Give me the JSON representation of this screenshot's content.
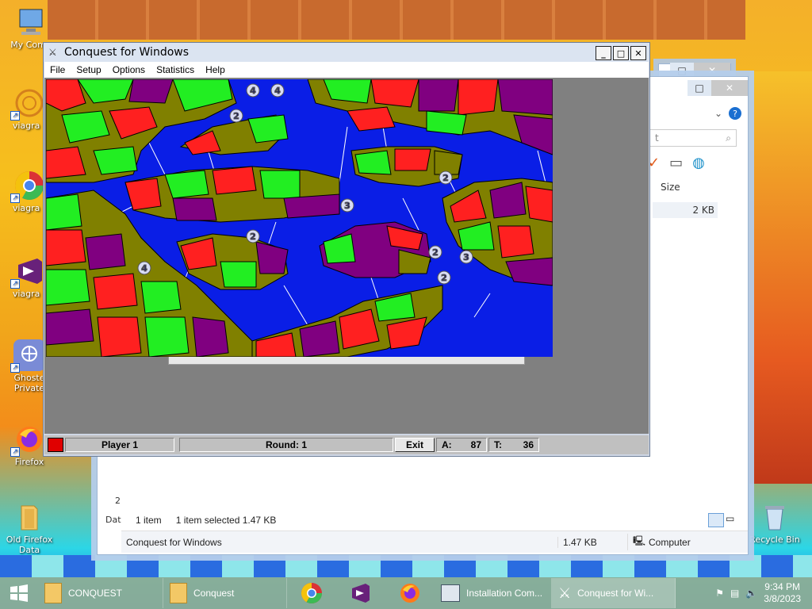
{
  "desktop": {
    "icons": [
      {
        "label": "My Comp"
      },
      {
        "label": "viagra ("
      },
      {
        "label": "viagra ("
      },
      {
        "label": "viagra ("
      },
      {
        "label": "Ghoste Private"
      },
      {
        "label": "Firefox"
      },
      {
        "label": "Old Firefox Data"
      },
      {
        "label": "Recycle Bin"
      }
    ]
  },
  "explorer": {
    "search_placeholder": "t",
    "column_size": "Size",
    "file_size": "2 KB",
    "status_items": "1 item",
    "status_selected": "1 item selected  1.47 KB",
    "details_name": "Conquest for Windows",
    "details_size": "1.47 KB",
    "details_location": "Computer",
    "left_marker_1": "2",
    "left_marker_2": "Dat"
  },
  "conquest": {
    "title": "Conquest for Windows",
    "menu": [
      "File",
      "Setup",
      "Options",
      "Statistics",
      "Help"
    ],
    "status": {
      "player": "Player 1",
      "round": "Round: 1",
      "exit": "Exit",
      "a_label": "A:",
      "a_value": "87",
      "t_label": "T:",
      "t_value": "36"
    },
    "player_color": "#e00000"
  },
  "taskbar": {
    "items": [
      {
        "label": "CONQUEST"
      },
      {
        "label": "Conquest"
      },
      {
        "label": "Installation Com..."
      },
      {
        "label": "Conquest for Wi..."
      }
    ],
    "time": "9:34 PM",
    "date": "3/8/2023"
  }
}
